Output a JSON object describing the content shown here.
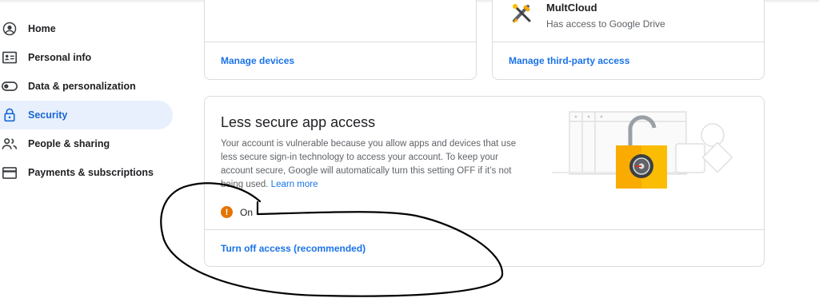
{
  "sidebar": {
    "items": [
      {
        "label": "Home",
        "icon": "account-circle-icon",
        "active": false
      },
      {
        "label": "Personal info",
        "icon": "id-card-icon",
        "active": false
      },
      {
        "label": "Data & personalization",
        "icon": "toggle-icon",
        "active": false
      },
      {
        "label": "Security",
        "icon": "lock-icon",
        "active": true
      },
      {
        "label": "People & sharing",
        "icon": "people-icon",
        "active": false
      },
      {
        "label": "Payments & subscriptions",
        "icon": "credit-card-icon",
        "active": false
      }
    ]
  },
  "devices_card": {
    "link": "Manage devices"
  },
  "third_party_card": {
    "app_name": "MultCloud",
    "app_access": "Has access to Google Drive",
    "link": "Manage third-party access"
  },
  "less_secure_card": {
    "title": "Less secure app access",
    "description": "Your account is vulnerable because you allow apps and devices that use less secure sign-in technology to access your account. To keep your account secure, Google will automatically turn this setting OFF if it’s not being used.",
    "learn_more": "Learn more",
    "status": "On",
    "action": "Turn off access (recommended)"
  },
  "colors": {
    "accent": "#1a73e8",
    "active_bg": "#e8f0fe",
    "warning": "#e37400",
    "lock": "#f9ab00"
  }
}
